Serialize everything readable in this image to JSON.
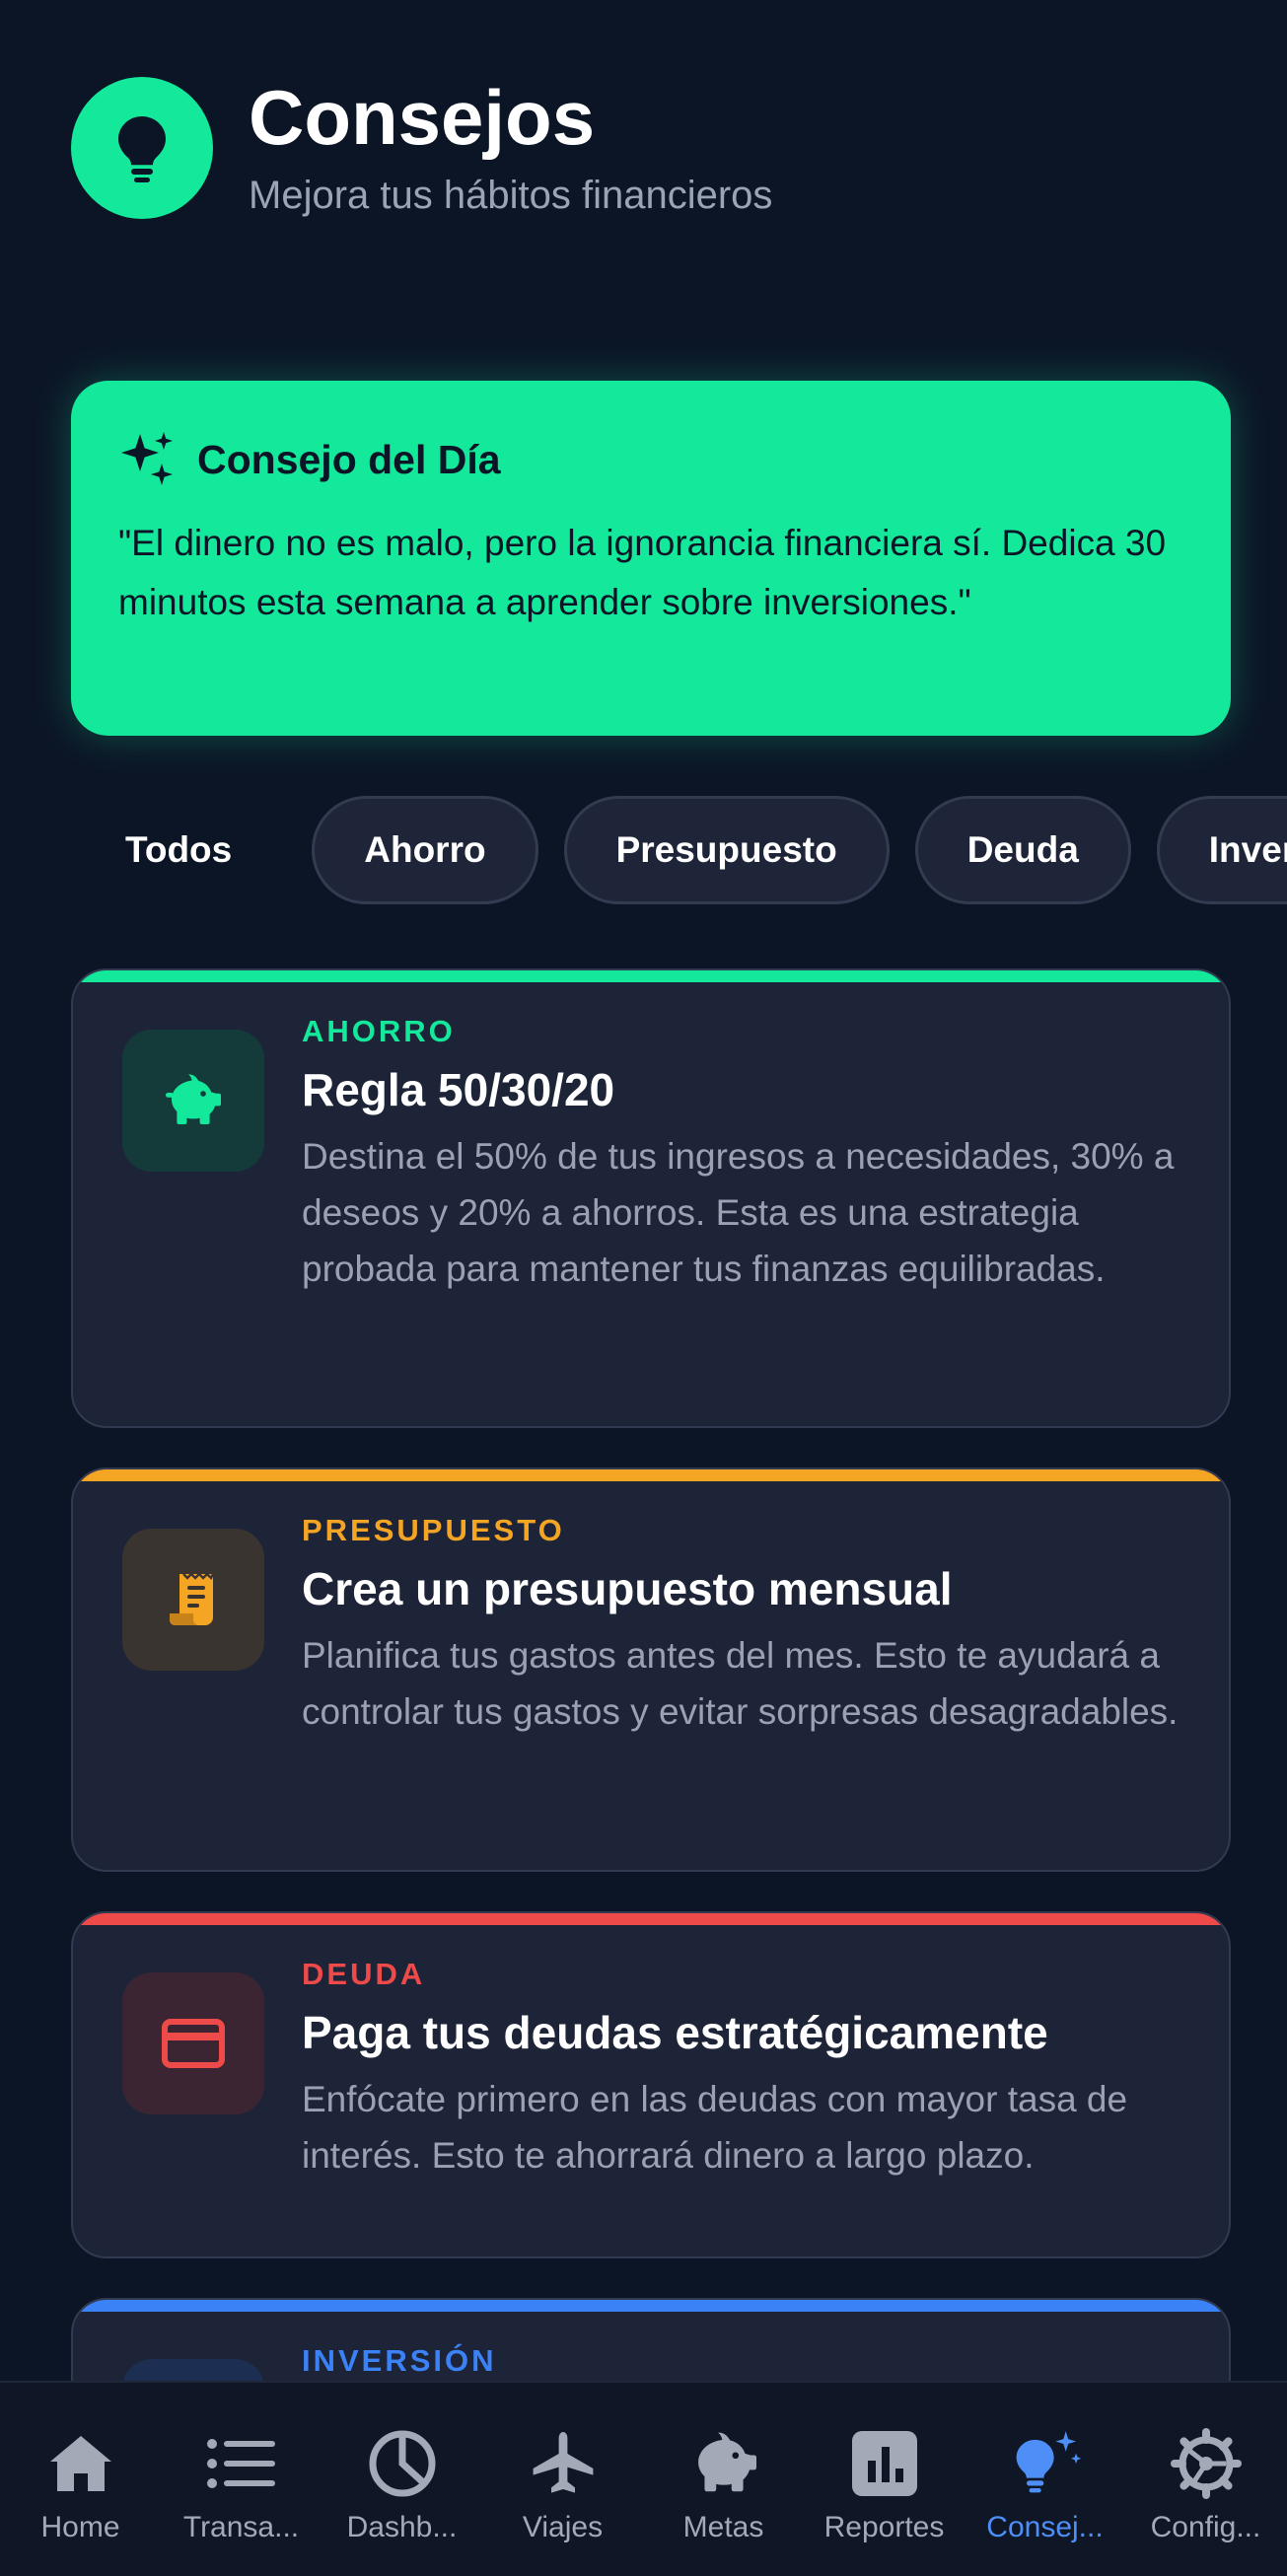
{
  "header": {
    "title": "Consejos",
    "subtitle": "Mejora tus hábitos financieros",
    "icon": "lightbulb-icon"
  },
  "tip_of_day": {
    "title": "Consejo del Día",
    "text": "\"El dinero no es malo, pero la ignorancia financiera sí. Dedica 30 minutos esta semana a aprender sobre inversiones.\"",
    "icon": "sparkles-icon",
    "color": "#14e89b"
  },
  "filters": {
    "items": [
      {
        "label": "Todos",
        "active": true
      },
      {
        "label": "Ahorro"
      },
      {
        "label": "Presupuesto"
      },
      {
        "label": "Deuda"
      },
      {
        "label": "Inversión"
      }
    ]
  },
  "cards": [
    {
      "category": "AHORRO",
      "title": "Regla 50/30/20",
      "description": "Destina el 50% de tus ingresos a necesidades, 30% a deseos y 20% a ahorros. Esta es una estrategia probada para mantener tus finanzas equilibradas.",
      "color": "#14e89b",
      "icon": "piggy-bank-icon"
    },
    {
      "category": "PRESUPUESTO",
      "title": "Crea un presupuesto mensual",
      "description": "Planifica tus gastos antes del mes. Esto te ayudará a controlar tus gastos y evitar sorpresas desagradables.",
      "color": "#f5a524",
      "icon": "receipt-icon"
    },
    {
      "category": "DEUDA",
      "title": "Paga tus deudas estratégicamente",
      "description": "Enfócate primero en las deudas con mayor tasa de interés. Esto te ahorrará dinero a largo plazo.",
      "color": "#ef4a4a",
      "icon": "credit-card-icon"
    },
    {
      "category": "INVERSIÓN",
      "color": "#3b82f6"
    }
  ],
  "bottom_nav": {
    "items": [
      {
        "label": "Home",
        "icon": "home-icon"
      },
      {
        "label": "Transa...",
        "icon": "list-icon"
      },
      {
        "label": "Dashb...",
        "icon": "pie-chart-icon"
      },
      {
        "label": "Viajes",
        "icon": "airplane-icon"
      },
      {
        "label": "Metas",
        "icon": "piggy-bank-icon"
      },
      {
        "label": "Reportes",
        "icon": "bar-chart-icon"
      },
      {
        "label": "Consej...",
        "icon": "lightbulb-icon",
        "active": true
      },
      {
        "label": "Config...",
        "icon": "gear-icon"
      }
    ],
    "active_color": "#4d8ff7"
  }
}
